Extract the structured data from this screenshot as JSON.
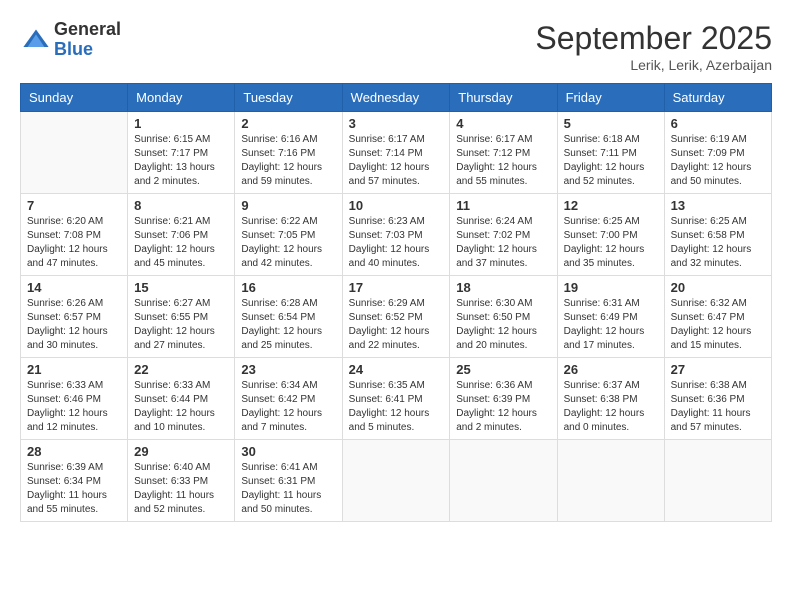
{
  "logo": {
    "general": "General",
    "blue": "Blue"
  },
  "title": "September 2025",
  "subtitle": "Lerik, Lerik, Azerbaijan",
  "days_of_week": [
    "Sunday",
    "Monday",
    "Tuesday",
    "Wednesday",
    "Thursday",
    "Friday",
    "Saturday"
  ],
  "weeks": [
    [
      {
        "day": "",
        "info": ""
      },
      {
        "day": "1",
        "info": "Sunrise: 6:15 AM\nSunset: 7:17 PM\nDaylight: 13 hours\nand 2 minutes."
      },
      {
        "day": "2",
        "info": "Sunrise: 6:16 AM\nSunset: 7:16 PM\nDaylight: 12 hours\nand 59 minutes."
      },
      {
        "day": "3",
        "info": "Sunrise: 6:17 AM\nSunset: 7:14 PM\nDaylight: 12 hours\nand 57 minutes."
      },
      {
        "day": "4",
        "info": "Sunrise: 6:17 AM\nSunset: 7:12 PM\nDaylight: 12 hours\nand 55 minutes."
      },
      {
        "day": "5",
        "info": "Sunrise: 6:18 AM\nSunset: 7:11 PM\nDaylight: 12 hours\nand 52 minutes."
      },
      {
        "day": "6",
        "info": "Sunrise: 6:19 AM\nSunset: 7:09 PM\nDaylight: 12 hours\nand 50 minutes."
      }
    ],
    [
      {
        "day": "7",
        "info": "Sunrise: 6:20 AM\nSunset: 7:08 PM\nDaylight: 12 hours\nand 47 minutes."
      },
      {
        "day": "8",
        "info": "Sunrise: 6:21 AM\nSunset: 7:06 PM\nDaylight: 12 hours\nand 45 minutes."
      },
      {
        "day": "9",
        "info": "Sunrise: 6:22 AM\nSunset: 7:05 PM\nDaylight: 12 hours\nand 42 minutes."
      },
      {
        "day": "10",
        "info": "Sunrise: 6:23 AM\nSunset: 7:03 PM\nDaylight: 12 hours\nand 40 minutes."
      },
      {
        "day": "11",
        "info": "Sunrise: 6:24 AM\nSunset: 7:02 PM\nDaylight: 12 hours\nand 37 minutes."
      },
      {
        "day": "12",
        "info": "Sunrise: 6:25 AM\nSunset: 7:00 PM\nDaylight: 12 hours\nand 35 minutes."
      },
      {
        "day": "13",
        "info": "Sunrise: 6:25 AM\nSunset: 6:58 PM\nDaylight: 12 hours\nand 32 minutes."
      }
    ],
    [
      {
        "day": "14",
        "info": "Sunrise: 6:26 AM\nSunset: 6:57 PM\nDaylight: 12 hours\nand 30 minutes."
      },
      {
        "day": "15",
        "info": "Sunrise: 6:27 AM\nSunset: 6:55 PM\nDaylight: 12 hours\nand 27 minutes."
      },
      {
        "day": "16",
        "info": "Sunrise: 6:28 AM\nSunset: 6:54 PM\nDaylight: 12 hours\nand 25 minutes."
      },
      {
        "day": "17",
        "info": "Sunrise: 6:29 AM\nSunset: 6:52 PM\nDaylight: 12 hours\nand 22 minutes."
      },
      {
        "day": "18",
        "info": "Sunrise: 6:30 AM\nSunset: 6:50 PM\nDaylight: 12 hours\nand 20 minutes."
      },
      {
        "day": "19",
        "info": "Sunrise: 6:31 AM\nSunset: 6:49 PM\nDaylight: 12 hours\nand 17 minutes."
      },
      {
        "day": "20",
        "info": "Sunrise: 6:32 AM\nSunset: 6:47 PM\nDaylight: 12 hours\nand 15 minutes."
      }
    ],
    [
      {
        "day": "21",
        "info": "Sunrise: 6:33 AM\nSunset: 6:46 PM\nDaylight: 12 hours\nand 12 minutes."
      },
      {
        "day": "22",
        "info": "Sunrise: 6:33 AM\nSunset: 6:44 PM\nDaylight: 12 hours\nand 10 minutes."
      },
      {
        "day": "23",
        "info": "Sunrise: 6:34 AM\nSunset: 6:42 PM\nDaylight: 12 hours\nand 7 minutes."
      },
      {
        "day": "24",
        "info": "Sunrise: 6:35 AM\nSunset: 6:41 PM\nDaylight: 12 hours\nand 5 minutes."
      },
      {
        "day": "25",
        "info": "Sunrise: 6:36 AM\nSunset: 6:39 PM\nDaylight: 12 hours\nand 2 minutes."
      },
      {
        "day": "26",
        "info": "Sunrise: 6:37 AM\nSunset: 6:38 PM\nDaylight: 12 hours\nand 0 minutes."
      },
      {
        "day": "27",
        "info": "Sunrise: 6:38 AM\nSunset: 6:36 PM\nDaylight: 11 hours\nand 57 minutes."
      }
    ],
    [
      {
        "day": "28",
        "info": "Sunrise: 6:39 AM\nSunset: 6:34 PM\nDaylight: 11 hours\nand 55 minutes."
      },
      {
        "day": "29",
        "info": "Sunrise: 6:40 AM\nSunset: 6:33 PM\nDaylight: 11 hours\nand 52 minutes."
      },
      {
        "day": "30",
        "info": "Sunrise: 6:41 AM\nSunset: 6:31 PM\nDaylight: 11 hours\nand 50 minutes."
      },
      {
        "day": "",
        "info": ""
      },
      {
        "day": "",
        "info": ""
      },
      {
        "day": "",
        "info": ""
      },
      {
        "day": "",
        "info": ""
      }
    ]
  ]
}
